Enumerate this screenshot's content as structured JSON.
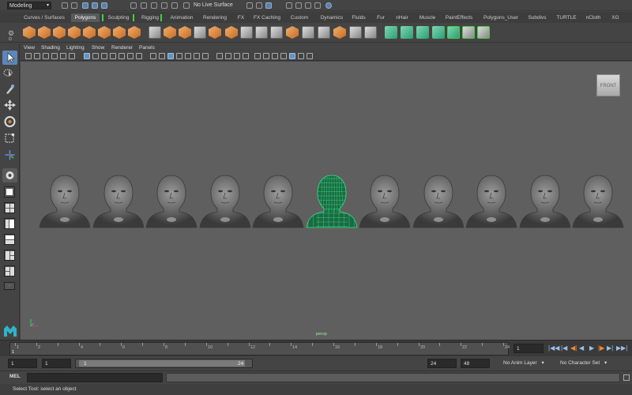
{
  "status_line": {
    "menu_set": "Modeling",
    "live_surface": "No Live Surface"
  },
  "shelf": {
    "tabs": [
      "Curves / Surfaces",
      "Polygons",
      "Sculpting",
      "Rigging",
      "Animation",
      "Rendering",
      "FX",
      "FX Caching",
      "Custom",
      "Dynamics",
      "Fluids",
      "Fur",
      "nHair",
      "Muscle",
      "PaintEffects",
      "Polygons_User",
      "Subdivs",
      "TURTLE",
      "nCloth",
      "XG"
    ],
    "active_tab": "Polygons"
  },
  "panel": {
    "menus": [
      "View",
      "Shading",
      "Lighting",
      "Show",
      "Renderer",
      "Panels"
    ]
  },
  "viewport": {
    "view_cube_label": "FRONT",
    "camera_label": "persp",
    "selected_head_index": 5,
    "head_count": 11,
    "colors": {
      "background": "#5f5f5f",
      "wireframe": "#3fe080",
      "mesh": "#8a8a8a"
    }
  },
  "time_slider": {
    "tick_labels": [
      "1",
      "2",
      "4",
      "6",
      "8",
      "10",
      "12",
      "14",
      "16",
      "18",
      "20",
      "22",
      "24"
    ],
    "current_frame": "1",
    "ruler_start_marker": "1"
  },
  "range": {
    "start_time": "1",
    "playback_start": "1",
    "range_start_label": "1",
    "range_end_label": "24",
    "playback_end": "24",
    "end_time": "48",
    "anim_layer": "No Anim Layer",
    "character_set": "No Character Set"
  },
  "command_line": {
    "label": "MEL"
  },
  "help_line": {
    "text": "Select Tool: select an object"
  }
}
